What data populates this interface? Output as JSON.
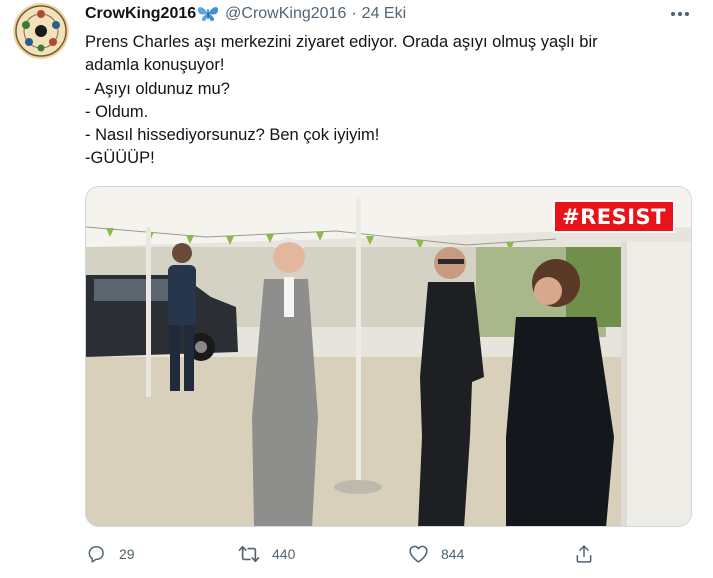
{
  "tweet": {
    "display_name": "CrowKing2016",
    "handle": "@CrowKing2016",
    "separator": "·",
    "date": "24 Eki",
    "text_lines": [
      "Prens Charles aşı merkezini ziyaret ediyor. Orada aşıyı olmuş yaşlı bir",
      "adamla konuşuyor!",
      "- Aşıyı oldunuz mu?",
      "- Oldum.",
      "- Nasıl hissediyorsunuz? Ben çok iyiyim!",
      "-GÜÜÜP!"
    ],
    "media": {
      "overlay_badge": "#RESIST",
      "badge_color": "#e8141a"
    },
    "actions": {
      "reply": {
        "icon": "reply-icon",
        "count": "29"
      },
      "retweet": {
        "icon": "retweet-icon",
        "count": "440"
      },
      "like": {
        "icon": "heart-icon",
        "count": "844"
      },
      "share": {
        "icon": "share-icon"
      }
    },
    "icons": {
      "verified_emoji": "butterfly-icon",
      "more": "more-icon"
    },
    "colors": {
      "text_primary": "#0f1419",
      "text_secondary": "#536471",
      "border": "#cfd9de"
    }
  }
}
